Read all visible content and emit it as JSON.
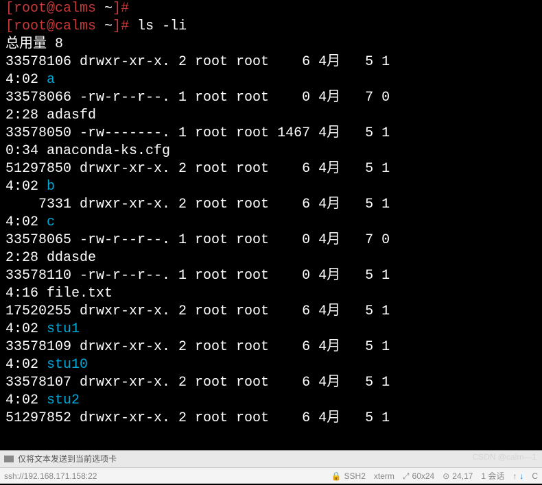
{
  "prompts": [
    {
      "user": "root",
      "host": "calms",
      "path": "~",
      "symbol": "#",
      "command": ""
    },
    {
      "user": "root",
      "host": "calms",
      "path": "~",
      "symbol": "#",
      "command": "ls -li"
    }
  ],
  "total_line": "总用量 8",
  "entries": [
    {
      "inode": "33578106",
      "perms": "drwxr-xr-x.",
      "links": "2",
      "owner": "root",
      "group": "root",
      "size": "6",
      "month": "4月",
      "day": "5",
      "t1": "1",
      "time": "4:02",
      "name": "a",
      "is_dir": true
    },
    {
      "inode": "33578066",
      "perms": "-rw-r--r--.",
      "links": "1",
      "owner": "root",
      "group": "root",
      "size": "0",
      "month": "4月",
      "day": "7",
      "t1": "0",
      "time": "2:28",
      "name": "adasfd",
      "is_dir": false
    },
    {
      "inode": "33578050",
      "perms": "-rw-------.",
      "links": "1",
      "owner": "root",
      "group": "root",
      "size": "1467",
      "month": "4月",
      "day": "5",
      "t1": "1",
      "time": "0:34",
      "name": "anaconda-ks.cfg",
      "is_dir": false
    },
    {
      "inode": "51297850",
      "perms": "drwxr-xr-x.",
      "links": "2",
      "owner": "root",
      "group": "root",
      "size": "6",
      "month": "4月",
      "day": "5",
      "t1": "1",
      "time": "4:02",
      "name": "b",
      "is_dir": true
    },
    {
      "inode": "    7331",
      "perms": "drwxr-xr-x.",
      "links": "2",
      "owner": "root",
      "group": "root",
      "size": "6",
      "month": "4月",
      "day": "5",
      "t1": "1",
      "time": "4:02",
      "name": "c",
      "is_dir": true
    },
    {
      "inode": "33578065",
      "perms": "-rw-r--r--.",
      "links": "1",
      "owner": "root",
      "group": "root",
      "size": "0",
      "month": "4月",
      "day": "7",
      "t1": "0",
      "time": "2:28",
      "name": "ddasde",
      "is_dir": false
    },
    {
      "inode": "33578110",
      "perms": "-rw-r--r--.",
      "links": "1",
      "owner": "root",
      "group": "root",
      "size": "0",
      "month": "4月",
      "day": "5",
      "t1": "1",
      "time": "4:16",
      "name": "file.txt",
      "is_dir": false
    },
    {
      "inode": "17520255",
      "perms": "drwxr-xr-x.",
      "links": "2",
      "owner": "root",
      "group": "root",
      "size": "6",
      "month": "4月",
      "day": "5",
      "t1": "1",
      "time": "4:02",
      "name": "stu1",
      "is_dir": true
    },
    {
      "inode": "33578109",
      "perms": "drwxr-xr-x.",
      "links": "2",
      "owner": "root",
      "group": "root",
      "size": "6",
      "month": "4月",
      "day": "5",
      "t1": "1",
      "time": "4:02",
      "name": "stu10",
      "is_dir": true
    },
    {
      "inode": "33578107",
      "perms": "drwxr-xr-x.",
      "links": "2",
      "owner": "root",
      "group": "root",
      "size": "6",
      "month": "4月",
      "day": "5",
      "t1": "1",
      "time": "4:02",
      "name": "stu2",
      "is_dir": true
    },
    {
      "inode": "51297852",
      "perms": "drwxr-xr-x.",
      "links": "2",
      "owner": "root",
      "group": "root",
      "size": "6",
      "month": "4月",
      "day": "5",
      "t1": "1",
      "time": "",
      "name": "",
      "is_dir": true,
      "truncated": true
    }
  ],
  "status_top": {
    "text": "仅将文本发送到当前选项卡"
  },
  "status_bottom": {
    "ssh": "ssh://192.168.171.158:22",
    "ssh2": "SSH2",
    "term": "xterm",
    "size": "60x24",
    "pos": "24,17",
    "session": "1 会话",
    "cap_glyph": "CAP"
  },
  "watermark": "CSDN @calm—1"
}
